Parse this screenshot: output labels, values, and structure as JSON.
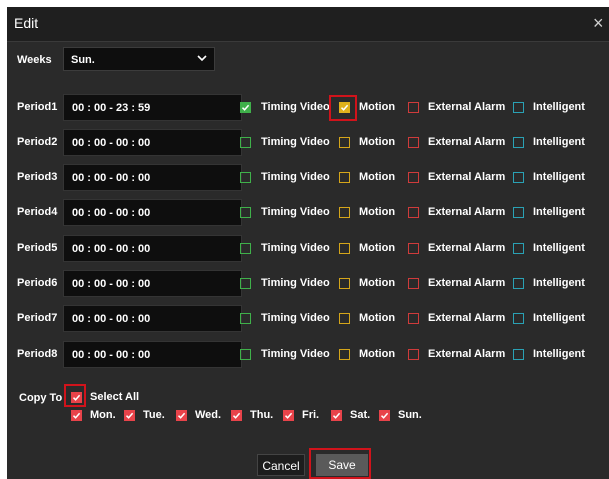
{
  "dialog": {
    "title": "Edit",
    "close_glyph": "×"
  },
  "weeks": {
    "label": "Weeks",
    "selected": "Sun."
  },
  "type_labels": {
    "timing": "Timing Video",
    "motion": "Motion",
    "alarm": "External Alarm",
    "intelligent": "Intelligent"
  },
  "colors": {
    "timing": "#3fb04a",
    "motion": "#e0b11c",
    "alarm": "#e8434a",
    "intelligent": "#2aa1b4",
    "highlight": "#d0131b"
  },
  "periods": [
    {
      "label": "Period1",
      "time": "00 : 00 - 23 : 59",
      "timing": true,
      "motion": true,
      "alarm": false,
      "intelligent": false
    },
    {
      "label": "Period2",
      "time": "00 : 00 - 00 : 00",
      "timing": false,
      "motion": false,
      "alarm": false,
      "intelligent": false
    },
    {
      "label": "Period3",
      "time": "00 : 00 - 00 : 00",
      "timing": false,
      "motion": false,
      "alarm": false,
      "intelligent": false
    },
    {
      "label": "Period4",
      "time": "00 : 00 - 00 : 00",
      "timing": false,
      "motion": false,
      "alarm": false,
      "intelligent": false
    },
    {
      "label": "Period5",
      "time": "00 : 00 - 00 : 00",
      "timing": false,
      "motion": false,
      "alarm": false,
      "intelligent": false
    },
    {
      "label": "Period6",
      "time": "00 : 00 - 00 : 00",
      "timing": false,
      "motion": false,
      "alarm": false,
      "intelligent": false
    },
    {
      "label": "Period7",
      "time": "00 : 00 - 00 : 00",
      "timing": false,
      "motion": false,
      "alarm": false,
      "intelligent": false
    },
    {
      "label": "Period8",
      "time": "00 : 00 - 00 : 00",
      "timing": false,
      "motion": false,
      "alarm": false,
      "intelligent": false
    }
  ],
  "copy_to": {
    "label": "Copy To",
    "select_all_label": "Select All",
    "select_all_checked": true,
    "days": [
      {
        "label": "Mon.",
        "checked": true
      },
      {
        "label": "Tue.",
        "checked": true
      },
      {
        "label": "Wed.",
        "checked": true
      },
      {
        "label": "Thu.",
        "checked": true
      },
      {
        "label": "Fri.",
        "checked": true
      },
      {
        "label": "Sat.",
        "checked": true
      },
      {
        "label": "Sun.",
        "checked": true
      }
    ]
  },
  "buttons": {
    "cancel": "Cancel",
    "save": "Save"
  }
}
